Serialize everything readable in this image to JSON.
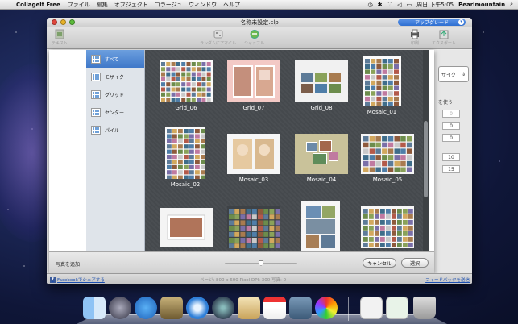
{
  "menubar": {
    "app_name": "Collagelt Free",
    "items": [
      "ファイル",
      "編集",
      "オブジェクト",
      "コラージュ",
      "ウィンドウ",
      "ヘルプ"
    ],
    "clock": "周日 下午5:05",
    "user": "Pearlmountain"
  },
  "window": {
    "title": "名称未設定.clp",
    "upgrade_label": "アップグレード",
    "toolbar": {
      "left_label": "テキスト",
      "center1_label": "ランダムにアマイル",
      "center2_label": "シャッフル",
      "print_label": "印刷",
      "export_label": "エクスポート"
    }
  },
  "sheet": {
    "categories": [
      {
        "label": "すべて",
        "selected": true
      },
      {
        "label": "モザイク",
        "selected": false
      },
      {
        "label": "グリッド",
        "selected": false
      },
      {
        "label": "センター",
        "selected": false
      },
      {
        "label": "パイル",
        "selected": false
      }
    ],
    "templates": [
      {
        "name": "Grid_06"
      },
      {
        "name": "Grid_07"
      },
      {
        "name": "Grid_08"
      },
      {
        "name": "Mosaic_01"
      },
      {
        "name": "Mosaic_02"
      },
      {
        "name": "Mosaic_03"
      },
      {
        "name": "Mosaic_04"
      },
      {
        "name": "Mosaic_05"
      },
      {
        "name": ""
      },
      {
        "name": ""
      },
      {
        "name": ""
      },
      {
        "name": ""
      }
    ],
    "add_photos_label": "写真を追加",
    "cancel_label": "キャンセル",
    "select_label": "選択"
  },
  "rightpanel": {
    "dropdown_value": "ザイク",
    "use_label": "を使う",
    "fields": [
      "0",
      "0",
      "0",
      "10",
      "15"
    ]
  },
  "statusbar": {
    "facebook_label": "Facebookでシェアする",
    "info": "ページ: 800 x 600 Pixel  DPI: 300  写真: 0",
    "feedback_label": "フィードバックを送信"
  },
  "colors": {
    "accent": "#3f78c9",
    "grid_bg": "#474b4f"
  }
}
